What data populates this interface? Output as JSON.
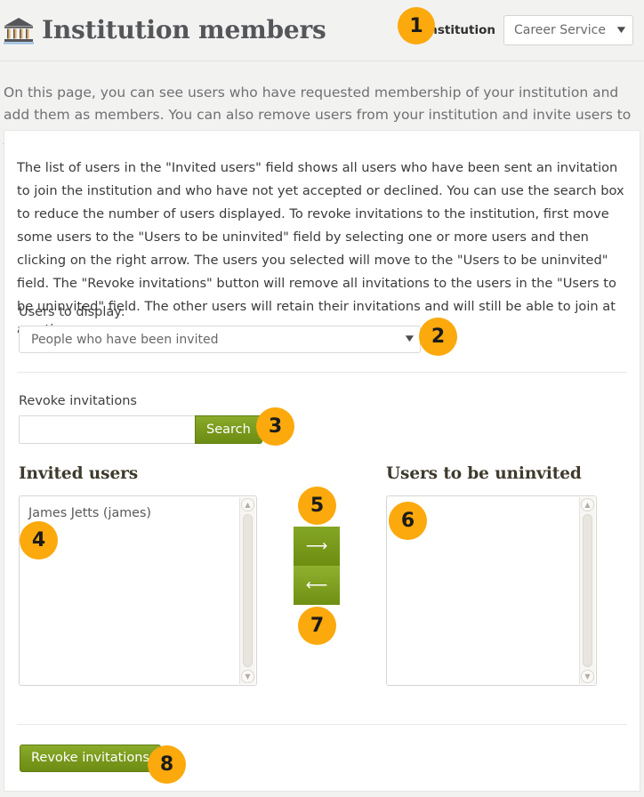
{
  "header": {
    "icon": "bank-institution-icon",
    "title": "Institution members",
    "institution_label": "Institution",
    "institution_value": "Career Service",
    "dropdown_caret": "▼"
  },
  "intro": {
    "text": "On this page, you can see users who have requested membership of your institution and add them as members. You can also remove users from your institution and invite users to join."
  },
  "info_panel": {
    "text": "The list of users in the \"Invited users\" field shows all users who have been sent an invitation to join the institution and who have not yet accepted or declined. You can use the search box to reduce the number of users displayed. To revoke invitations to the institution, first move some users to the \"Users to be uninvited\" field by selecting one or more users and then clicking on the right arrow. The users you selected will move to the \"Users to be uninvited\" field. The \"Revoke invitations\" button will remove all invitations to the users in the \"Users to be uninvited\" field. The other users will retain their invitations and will still be able to join at any time."
  },
  "display_filter": {
    "label": "Users to display:",
    "value": "People who have been invited",
    "caret": "▼"
  },
  "search": {
    "label": "Revoke invitations",
    "value": "",
    "placeholder": "",
    "button_label": "Search"
  },
  "lists": {
    "left": {
      "heading": "Invited users",
      "items": [
        "James Jetts (james)"
      ]
    },
    "right": {
      "heading": "Users to be uninvited",
      "items": []
    },
    "scroll_up_glyph": "▲",
    "scroll_down_glyph": "▼"
  },
  "transfer": {
    "right_arrow": "⟶",
    "left_arrow": "⟵"
  },
  "footer": {
    "revoke_label": "Revoke invitations"
  },
  "callouts": {
    "one": "1",
    "two": "2",
    "three": "3",
    "four": "4",
    "five": "5",
    "six": "6",
    "seven": "7",
    "eight": "8"
  },
  "colors": {
    "badge": "#fba90c",
    "button_green": "#7a9a1d",
    "page_background": "#f2f2f1",
    "card_background": "#ffffff"
  }
}
